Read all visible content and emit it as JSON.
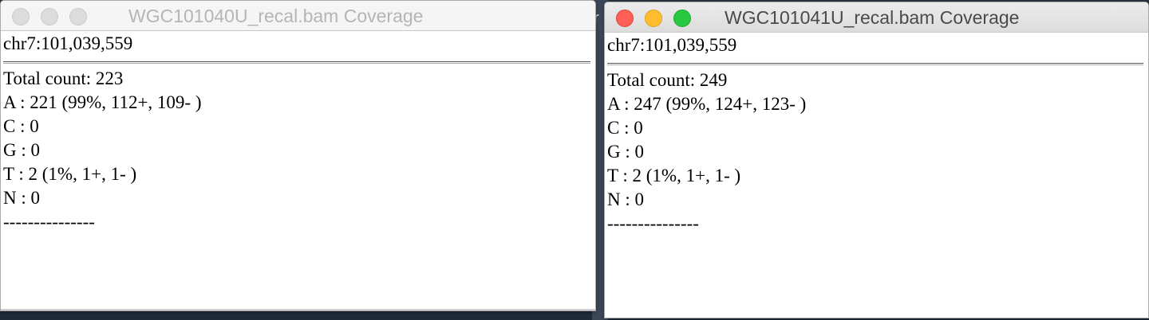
{
  "background": {
    "glyph": "r",
    "color": "#2b3340"
  },
  "windows": [
    {
      "title": "WGC101040U_recal.bam Coverage",
      "active": false,
      "locus": "chr7:101,039,559",
      "total": "Total count: 223",
      "bases": [
        "A : 221 (99%, 112+, 109- )",
        "C : 0",
        "G : 0",
        "T : 2 (1%, 1+, 1- )",
        "N : 0"
      ],
      "separator": "---------------"
    },
    {
      "title": "WGC101041U_recal.bam Coverage",
      "active": true,
      "locus": "chr7:101,039,559",
      "total": "Total count: 249",
      "bases": [
        "A : 247 (99%, 124+, 123- )",
        "C : 0",
        "G : 0",
        "T : 2 (1%, 1+, 1- )",
        "N : 0"
      ],
      "separator": "---------------"
    }
  ],
  "colors": {
    "close": "#fe5f57",
    "minimize": "#febc2e",
    "zoom": "#28c840",
    "inactive_light": "#dcdcdc"
  }
}
